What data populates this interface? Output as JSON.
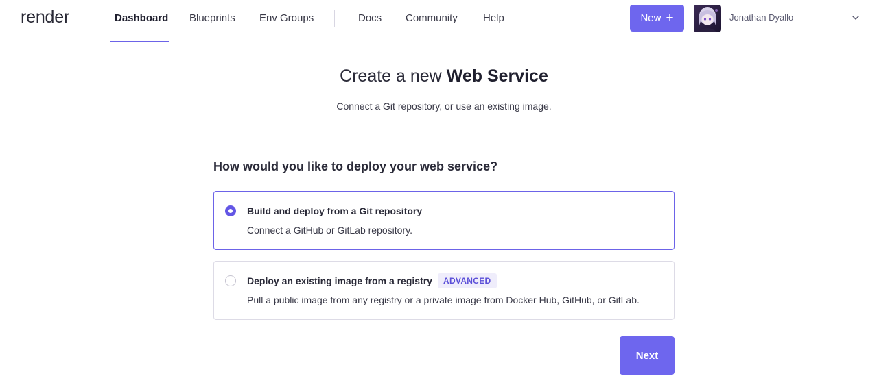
{
  "header": {
    "logo": "render",
    "nav": [
      "Dashboard",
      "Blueprints",
      "Env Groups"
    ],
    "nav_secondary": [
      "Docs",
      "Community",
      "Help"
    ],
    "active_nav": "Dashboard",
    "new_label": "New",
    "user_name": "Jonathan Dyallo"
  },
  "main": {
    "title_prefix": "Create a new",
    "title_emphasis": "Web Service",
    "subtitle": "Connect a Git repository, or use an existing image.",
    "question": "How would you like to deploy your web service?",
    "options": [
      {
        "title": "Build and deploy from a Git repository",
        "description": "Connect a GitHub or GitLab repository.",
        "selected": true
      },
      {
        "title": "Deploy an existing image from a registry",
        "badge": "ADVANCED",
        "description": "Pull a public image from any registry or a private image from Docker Hub, GitHub, or GitLab.",
        "selected": false
      }
    ],
    "next_label": "Next"
  },
  "colors": {
    "accent": "#6e66ee",
    "accent_border": "#6c63e8",
    "badge_bg": "#efedfb",
    "badge_text": "#5b4fd8"
  },
  "icons": {
    "new": "plus-icon",
    "user_menu": "chevron-down-icon"
  }
}
